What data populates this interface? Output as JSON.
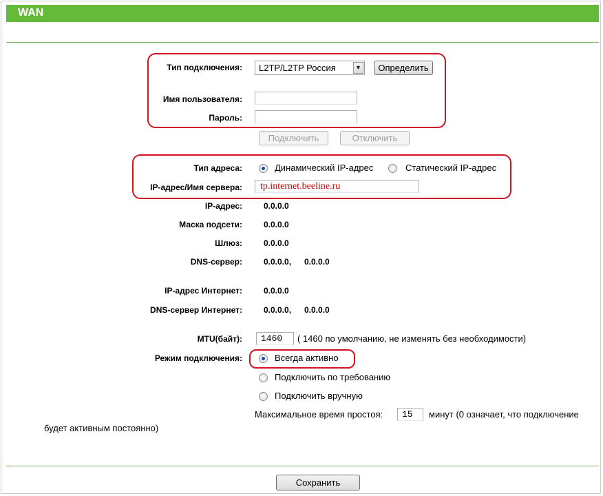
{
  "window": {
    "title": "WAN"
  },
  "connection": {
    "type_label": "Тип подключения:",
    "type_value": "L2TP/L2TP Россия",
    "detect_button": "Определить",
    "username_label": "Имя пользователя:",
    "username_value": "",
    "password_label": "Пароль:",
    "password_value": "",
    "connect_button": "Подключить",
    "disconnect_button": "Отключить"
  },
  "address": {
    "type_label": "Тип адреса:",
    "dynamic_label": "Динамический IP-адрес",
    "static_label": "Статический IP-адрес",
    "selected": "dynamic",
    "server_label": "IP-адрес/Имя сервера:",
    "server_value": "tp.internet.beeline.ru"
  },
  "status": {
    "ip_label": "IP-адрес:",
    "ip_value": "0.0.0.0",
    "mask_label": "Маска подсети:",
    "mask_value": "0.0.0.0",
    "gateway_label": "Шлюз:",
    "gateway_value": "0.0.0.0",
    "dns_label": "DNS-сервер:",
    "dns_value1": "0.0.0.0,",
    "dns_value2": "0.0.0.0",
    "inet_ip_label": "IP-адрес Интернет:",
    "inet_ip_value": "0.0.0.0",
    "inet_dns_label": "DNS-сервер Интернет:",
    "inet_dns_value1": "0.0.0.0,",
    "inet_dns_value2": "0.0.0.0"
  },
  "mtu": {
    "label": "MTU(байт):",
    "value": "1460",
    "hint": "( 1460 по умолчанию, не изменять без необходимости)"
  },
  "mode": {
    "label": "Режим подключения:",
    "always": "Всегда активно",
    "on_demand": "Подключить по требованию",
    "manual": "Подключить вручную",
    "selected": "always",
    "idle_label": "Максимальное время простоя:",
    "idle_value": "15",
    "idle_hint_1": "минут (0 означает, что подключение",
    "idle_hint_2": "будет активным постоянно)"
  },
  "footer": {
    "save_button": "Сохранить"
  },
  "colors": {
    "header": "#65ba3a",
    "highlight": "#d4111e",
    "server_text": "#cc0000"
  }
}
